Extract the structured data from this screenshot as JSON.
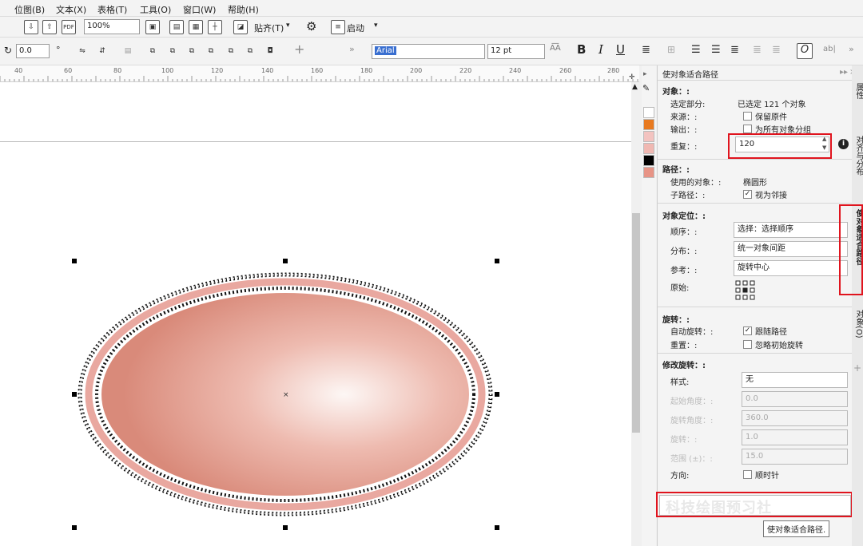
{
  "menu": [
    "位图(B)",
    "文本(X)",
    "表格(T)",
    "工具(O)",
    "窗口(W)",
    "帮助(H)"
  ],
  "toolbar": {
    "zoom": "100%",
    "snap_label": "贴齐(T)",
    "launch_label": "启动",
    "rotation": "0.0",
    "font_name": "Arial",
    "font_size": "12 pt",
    "bold": "B",
    "italic": "I",
    "underline": "U"
  },
  "ruler_ticks": [
    "40",
    "60",
    "80",
    "100",
    "120",
    "140",
    "160",
    "180",
    "200",
    "220",
    "240",
    "260",
    "280"
  ],
  "palette": [
    "#ffffff",
    "#e87a20",
    "#f3c3c0",
    "#f0b8b2",
    "#000000",
    "#e79486"
  ],
  "docker": {
    "title": "使对象适合路径",
    "object_section": "对象：:",
    "selected_label": "选定部分:",
    "selected_value": "已选定 121 个对象",
    "source_label": "来源：:",
    "source_option": "保留原件",
    "output_label": "输出：:",
    "output_option": "为所有对象分组",
    "repeat_label": "重复：:",
    "repeat_value": "120",
    "path_section": "路径：:",
    "used_object_label": "使用的对象：:",
    "used_object_value": "椭圆形",
    "subpath_label": "子路径：:",
    "subpath_option": "视为邻接",
    "positioning_section": "对象定位：:",
    "order_label": "顺序：:",
    "order_value": "选择：选择顺序",
    "distribute_label": "分布：:",
    "distribute_value": "统一对象间距",
    "reference_label": "参考：:",
    "reference_value": "旋转中心",
    "origin_label": "原始:",
    "rotation_section": "旋转：:",
    "auto_rotate_label": "自动旋转：:",
    "auto_rotate_option": "跟随路径",
    "reset_label": "重置：:",
    "reset_option": "忽略初始旋转",
    "modify_rotation_section": "修改旋转：:",
    "style_label": "样式:",
    "style_value": "无",
    "start_angle_label": "起始角度：:",
    "start_angle_value": "0.0",
    "rotate_angle_label": "旋转角度：:",
    "rotate_angle_value": "360.0",
    "rotation_label": "旋转：:",
    "rotation_value": "1.0",
    "range_label": "范围 (±)：:",
    "range_value": "15.0",
    "direction_label": "方向:",
    "clockwise_option": "顺时针",
    "tooltip": "使对象适合路径.",
    "watermark": "科技绘图预习社"
  },
  "side_tabs": [
    "属性",
    "对齐与分布",
    "使对象适合路径",
    "对象(O)"
  ]
}
